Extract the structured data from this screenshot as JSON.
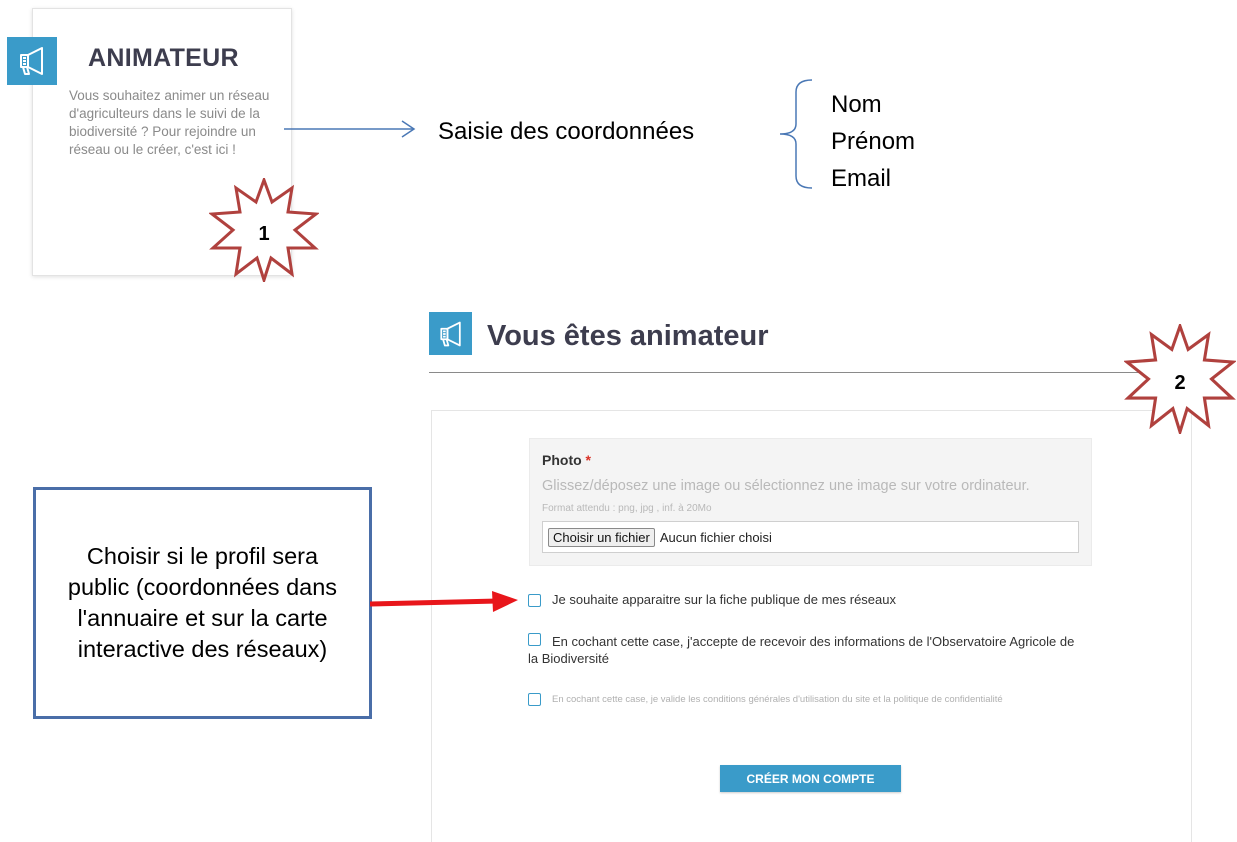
{
  "card": {
    "title": "ANIMATEUR",
    "description": "Vous souhaitez animer un réseau d'agriculteurs dans le suivi de la biodiversité ? Pour rejoindre un réseau ou le créer, c'est ici !",
    "icon": "megaphone-icon",
    "accent": "#3a9bc9"
  },
  "badges": {
    "one": "1",
    "two": "2",
    "star_color": "#b0413e"
  },
  "annotation": {
    "saisie": "Saisie des coordonnées",
    "fields": [
      "Nom",
      "Prénom",
      "Email"
    ]
  },
  "section": {
    "title": "Vous êtes animateur",
    "icon": "megaphone-icon"
  },
  "form": {
    "photo_label": "Photo",
    "required_mark": "*",
    "photo_hint": "Glissez/déposez une image ou sélectionnez une image sur votre ordinateur.",
    "photo_format": "Format attendu : png, jpg , inf. à 20Mo",
    "file_button": "Choisir un fichier",
    "file_status": "Aucun fichier choisi",
    "checkbox_public": "Je souhaite apparaitre sur la fiche publique de mes réseaux",
    "checkbox_info": "En cochant cette case, j'accepte de recevoir des informations de l'Observatoire Agricole de la Biodiversité",
    "checkbox_cgu": "En cochant cette case, je valide les conditions générales d'utilisation du site et la politique de confidentialité",
    "submit": "CRÉER MON COMPTE"
  },
  "callout": {
    "text": "Choisir si le profil sera public (coordonnées dans l'annuaire et sur la carte interactive des réseaux)",
    "border_color": "#4a6ea8",
    "arrow_color": "#e8161b"
  }
}
